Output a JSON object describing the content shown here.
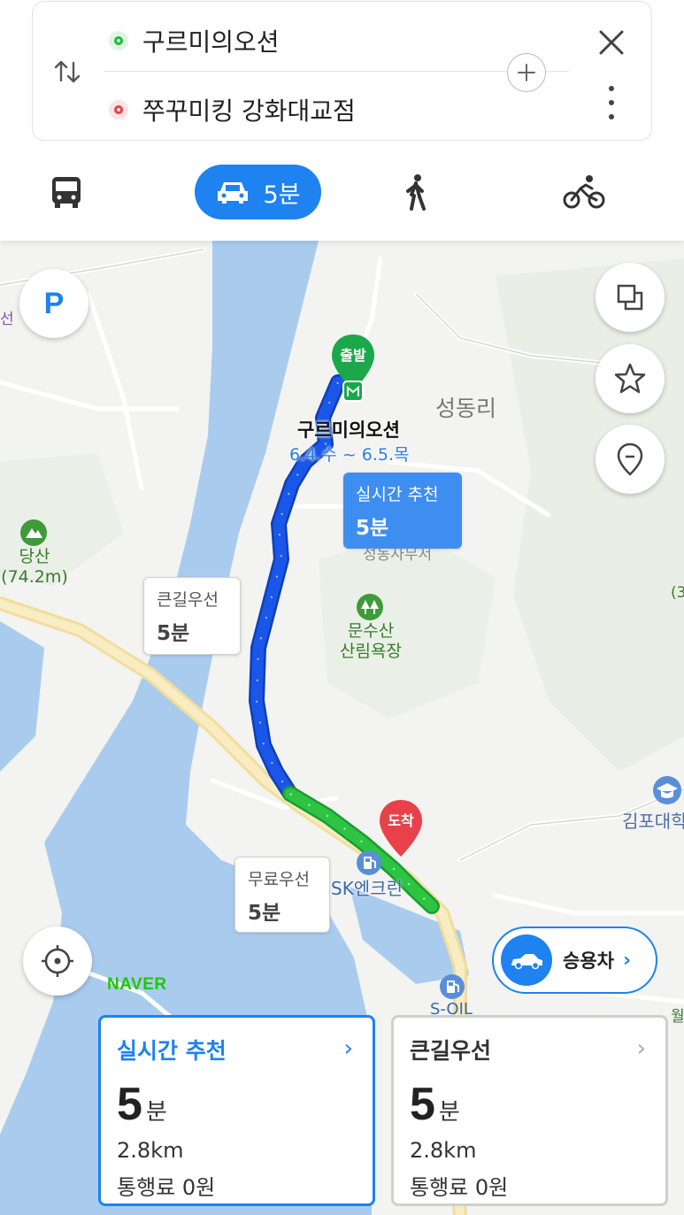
{
  "route": {
    "origin": "구르미의오션",
    "destination": "쭈꾸미킹 강화대교점"
  },
  "modes": {
    "car_time": "5분",
    "selected": "car"
  },
  "map": {
    "labels": {
      "village": "성동리",
      "mountain_name": "당산",
      "mountain_height": "(74.2m)",
      "forest_line1": "문수산",
      "forest_line2": "산림욕장",
      "school": "김포대학",
      "gas_sk": "SK엔크린",
      "gas_soil": "S-OIL",
      "partial_right": "(3",
      "partial_right2": "월",
      "partial_left": "선",
      "under_bubble": "성동사무서"
    },
    "markers": {
      "start_label": "출발",
      "end_label": "도착",
      "origin_name": "구르미의오션",
      "origin_date": "6.4.수 ~ 6.5.목"
    },
    "bubbles": {
      "realtime": {
        "title": "실시간 추천",
        "time": "5분"
      },
      "bigroad": {
        "title": "큰길우선",
        "time": "5분"
      },
      "free": {
        "title": "무료우선",
        "time": "5분"
      }
    },
    "parking_label": "P",
    "logo": "NAVER",
    "car_type": "승용차",
    "chevron": "›"
  },
  "cards": [
    {
      "title": "실시간 추천",
      "time_num": "5",
      "time_unit": "분",
      "distance": "2.8km",
      "toll": "통행료 0원",
      "chevron": "›"
    },
    {
      "title": "큰길우선",
      "time_num": "5",
      "time_unit": "분",
      "distance": "2.8km",
      "toll": "통행료 0원",
      "chevron": "›"
    }
  ],
  "colors": {
    "accent": "#1e82f0",
    "route_blue": "#1a56e8",
    "route_green": "#2ec443",
    "start_marker": "#1aa84a",
    "end_marker": "#e8414b",
    "river": "#a9cbee"
  }
}
